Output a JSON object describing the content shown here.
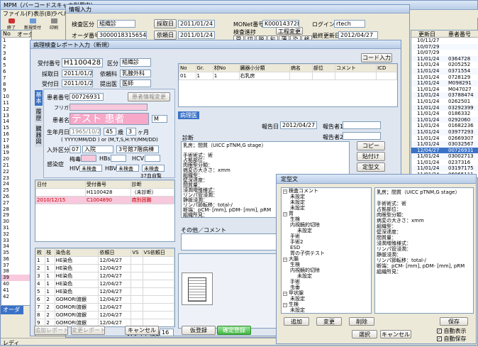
{
  "main": {
    "title": "MPM（バーコードスキャナ利用中）",
    "menu": [
      "ファイル(F)",
      "表示(B)",
      "ラベル(L)"
    ],
    "toolbar": [
      "終了",
      "新規受付",
      "印刷"
    ],
    "headers": {
      "no": "No",
      "order": "オーダ番号",
      "date": "更新日",
      "patient": "患者番号"
    },
    "left_rows": [
      "1",
      "2",
      "3",
      "4",
      "5",
      "6",
      "7",
      "8",
      "9",
      "10",
      "11",
      "12",
      "13",
      "14",
      "15",
      "16",
      "17",
      "18",
      "19",
      "20",
      "21",
      "22",
      "23",
      "24",
      "25",
      "26",
      "27",
      "28",
      "29",
      "30",
      "31",
      "32",
      "33",
      "34",
      "35",
      "36",
      "37",
      "38",
      "39",
      "40",
      "41",
      "42"
    ],
    "right_rows": [
      [
        "10/11/27",
        ""
      ],
      [
        "10/07/29",
        ""
      ],
      [
        "10/07/29",
        ""
      ],
      [
        "11/01/24",
        "0364728"
      ],
      [
        "11/01/24",
        "0205252"
      ],
      [
        "11/01/24",
        "0371554"
      ],
      [
        "11/01/24",
        "0728129"
      ],
      [
        "11/01/24",
        "M098291"
      ],
      [
        "11/01/24",
        "M047027"
      ],
      [
        "11/01/24",
        "03788474"
      ],
      [
        "11/01/24",
        "0262501"
      ],
      [
        "11/01/24",
        "03292399"
      ],
      [
        "11/01/24",
        "0186332"
      ],
      [
        "11/01/24",
        "0292060"
      ],
      [
        "11/01/24",
        "01682236"
      ],
      [
        "11/01/24",
        "03977293"
      ],
      [
        "11/01/24",
        "02669307"
      ],
      [
        "11/01/24",
        "03032567"
      ],
      [
        "12/04/27",
        "00726931"
      ],
      [
        "11/01/24",
        "03002713"
      ],
      [
        "11/01/24",
        "0237316"
      ],
      [
        "11/01/24",
        "03197175"
      ],
      [
        "11/01/24",
        "06965111"
      ]
    ],
    "status": "レディ",
    "bottom_tab": "オーダ"
  },
  "info": {
    "title": "情報入力",
    "kensa_label": "検査区分",
    "kensa_val": "組織診",
    "uketsuke_label": "採取日",
    "uketsuke_val": "2011/01/24",
    "order_label": "オーダ番号",
    "order_val": "3000018315654",
    "irai_label": "依頼日",
    "irai_val": "2011/01/24",
    "monet_label": "MONet番号",
    "monet_val": "K000143728",
    "kensa_state_label": "検査進捗",
    "login_label": "ログイン",
    "login_val": "rtech",
    "koutei_btn": "工程変更",
    "saishu_label": "最終更新日",
    "saishu_val": "2012/04/27",
    "steps": [
      "受",
      "切",
      "脱",
      "包",
      "薄",
      "染",
      "検"
    ]
  },
  "report": {
    "title": "病理検査レポート入力（新規）",
    "code_btn": "コード入力",
    "uketsuke_no_label": "受付番号",
    "uketsuke_no_val": "H1100428",
    "kubun_label": "区分",
    "kubun_val": "組織診",
    "saishu_label": "採取日",
    "saishu_val": "2011/01/24",
    "iraika_label": "依頼科",
    "iraika_val": "乳腺外科",
    "uketsukebi_label": "受付日",
    "uketsukebi_val": "2011/01/24",
    "teishutsui_label": "提出医",
    "teishutsui_val": "医師",
    "vtabs": [
      "基本",
      "履歴",
      "臓器図"
    ],
    "patient_no_label": "患者番号",
    "patient_no_val": "00726931",
    "patient_btn": "患者情報変更",
    "furigana_label": "フリガナ",
    "name_label": "患者名",
    "name_val": "テスト 患者",
    "sex_val": "M",
    "birth_label": "生年月日",
    "birth_val": "1965/10/21",
    "age_val": "45",
    "age_unit": "歳",
    "month_val": "3",
    "month_unit": "ヶ月",
    "birth_hint": "( YYYY/MM/DD ) or (M,T,S,H:YY/MM/DD)",
    "nyugai_label": "入外区分",
    "nyugai_code": "07",
    "nyugai_val": "入院",
    "ward_val": "3号館7階病棟",
    "kansen_label": "感染症",
    "baidoku": "梅毒",
    "hbs": "HBs",
    "hcv": "HCV",
    "hiv": "HIV",
    "hbv": "HBV",
    "hcv2": "HCV",
    "mikensa": "未検査",
    "kansen_note": "37血自覧",
    "hist_headers": [
      "日付",
      "受付番号",
      "診断"
    ],
    "hist_rows": [
      [
        "",
        "H1100428",
        "（未診断）"
      ],
      [
        "2010/12/15",
        "C1004890",
        "癌別困難"
      ]
    ],
    "stain_headers": [
      "枚",
      "枝",
      "染色名",
      "依頼日",
      "VS",
      "VS依頼日"
    ],
    "stain_rows": [
      [
        "1",
        "1",
        "HE染色",
        "12/04/27"
      ],
      [
        "2",
        "1",
        "HE染色",
        "12/04/27"
      ],
      [
        "3",
        "1",
        "HE染色",
        "12/04/27"
      ],
      [
        "4",
        "1",
        "HE染色",
        "12/04/27"
      ],
      [
        "5",
        "1",
        "HE染色",
        "12/04/27"
      ],
      [
        "6",
        "2",
        "GOMORI渡銀",
        "12/04/27"
      ],
      [
        "7",
        "2",
        "GOMORI渡銀",
        "12/04/27"
      ],
      [
        "8",
        "2",
        "GOMORI渡銀",
        "12/04/27"
      ],
      [
        "9",
        "2",
        "GOMORI渡銀",
        "12/04/27"
      ]
    ],
    "tokusen_btn": "特染依頼",
    "slide_label": "スライド枚数",
    "slide_val": "16",
    "spec_headers": [
      "No",
      "Gr.",
      "材No",
      "臓器小分類",
      "病名",
      "部位",
      "コメント",
      "ICD"
    ],
    "spec_rows": [
      [
        "01",
        "1",
        "1",
        "右乳房",
        "",
        "",
        "",
        ""
      ]
    ],
    "byourii_tab": "病理医",
    "houkoku_label": "報告日",
    "houkoku_val": "2012/04/27",
    "houkokusha1_label": "報告者1",
    "houkokusha2_label": "報告者2",
    "shindan_label": "診断",
    "shindan_text": [
      "乳房；間質（UICC pTNM,G stage）",
      "",
      "手術術式：術",
      "占拠部位：",
      "肉眼型分類：",
      "病変の大きさ：xmm",
      "組織型：",
      "壁深達度：",
      "間質量：",
      "浸潤増殖様式：",
      "リンパ管浸潤：",
      "静脈浸潤：",
      "リンパ節転移：total-/",
      "断端：pCM- [mm], pDM- [mm], pRM",
      "組織所見："
    ],
    "copy_btn": "コピー",
    "paste_btn": "貼付け",
    "teikei_btn": "定型文",
    "sonota_label": "その他／コメント",
    "add_report_btn": "追加レポート",
    "change_report_btn": "変更レポート",
    "cancel_btn": "キャンセル",
    "kari_btn": "仮登録",
    "kakutei_btn": "確定登録"
  },
  "teikei": {
    "title": "定型文",
    "tree": [
      "検査コメント",
      "未設定",
      "未設定",
      "未設定",
      "胃",
      "生検",
      "内視鏡的切除",
      "未設定",
      "手術",
      "手術2",
      "ESD",
      "胃の子供テスト",
      "大腸",
      "生検",
      "内視鏡的切除",
      "未設定",
      "手術",
      "虫垂",
      "甲状腺",
      "未設定",
      "生検",
      "未設定"
    ],
    "preview": [
      "乳房；間質（UICC pTNM,G stage）",
      "",
      "手術術式：術",
      "占拠部位：",
      "肉眼型分類：",
      "病変の大きさ：xmm",
      "組織型：",
      "壁深達度：",
      "間質量：",
      "浸潤増殖様式：",
      "リンパ管浸潤：",
      "静脈浸潤：",
      "リンパ節転移：total-/",
      "断端：pCM- [mm], pDM- [mm], pRM",
      "組織所見："
    ],
    "add_btn": "追加",
    "change_btn": "変更",
    "delete_btn": "削除",
    "save_btn": "保存",
    "select_btn": "選択",
    "cancel_btn": "キャンセル",
    "auto_show": "自動表示",
    "auto_save": "自動保存"
  }
}
